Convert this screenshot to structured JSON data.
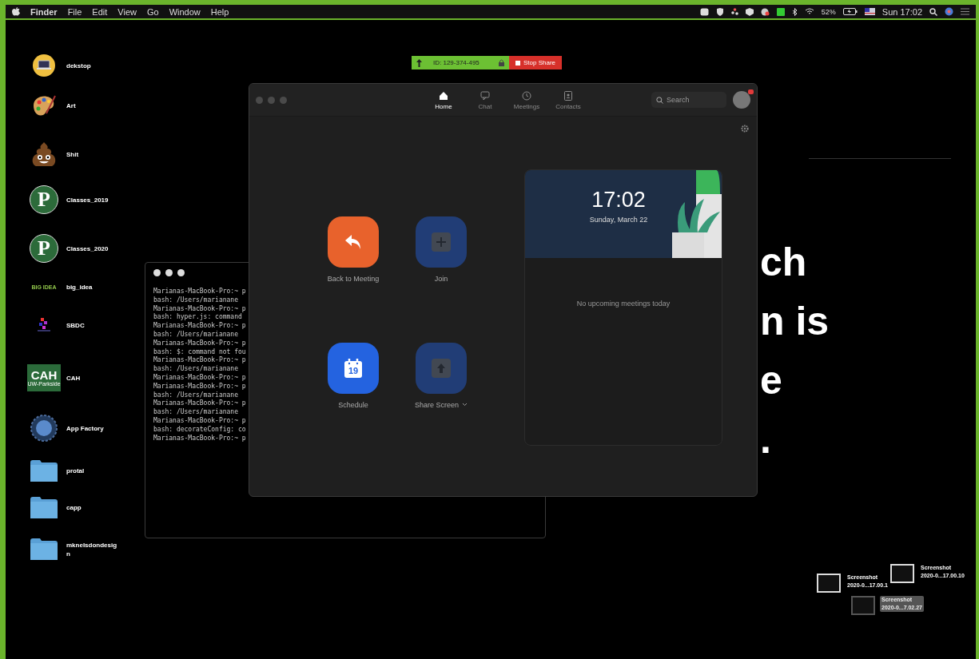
{
  "menu_bar": {
    "app": "Finder",
    "menus": [
      "File",
      "Edit",
      "View",
      "Go",
      "Window",
      "Help"
    ],
    "battery": "52%",
    "clock": "Sun 17:02"
  },
  "desktop_icons": [
    {
      "label": "dekstop",
      "kind": "laptop"
    },
    {
      "label": "Art",
      "kind": "palette"
    },
    {
      "label": "Shit",
      "kind": "emoji"
    },
    {
      "label": "Classes_2019",
      "kind": "p-logo",
      "logo_text": "P"
    },
    {
      "label": "Classes_2020",
      "kind": "p-logo",
      "logo_text": "P"
    },
    {
      "label": "big_idea",
      "kind": "wordmark",
      "logo_text": "BIG IDEA"
    },
    {
      "label": "SBDC",
      "kind": "mini-logo"
    },
    {
      "label": "CAH",
      "kind": "badge-logo",
      "logo_text": "CAH",
      "logo_subtext": "UW-Parkside"
    },
    {
      "label": "App Factory",
      "kind": "gear-logo"
    },
    {
      "label": "protal",
      "kind": "folder"
    },
    {
      "label": "capp",
      "kind": "folder"
    },
    {
      "label": "mknelsdondesig n",
      "kind": "folder"
    }
  ],
  "share_bar": {
    "meeting_id": "ID: 129-374-495",
    "stop_label": "Stop Share"
  },
  "background_text": [
    "ch",
    "n is",
    "e",
    "."
  ],
  "terminal": {
    "lines": [
      "Marianas-MacBook-Pro:~ p",
      "bash: /Users/marianane",
      "Marianas-MacBook-Pro:~ p",
      "bash: hyper.js: command",
      "Marianas-MacBook-Pro:~ p",
      "bash: /Users/marianane",
      "Marianas-MacBook-Pro:~ p",
      "bash: $: command not fou",
      "Marianas-MacBook-Pro:~ p",
      "bash: /Users/marianane",
      "Marianas-MacBook-Pro:~ p",
      "Marianas-MacBook-Pro:~ p",
      "bash: /Users/marianane",
      "Marianas-MacBook-Pro:~ p",
      "bash: /Users/marianane",
      "Marianas-MacBook-Pro:~ p",
      "bash: decorateConfig: co",
      "Marianas-MacBook-Pro:~ p"
    ]
  },
  "zoom_window": {
    "tabs": [
      {
        "label": "Home",
        "kind": "home",
        "selected": true
      },
      {
        "label": "Chat",
        "kind": "chat",
        "selected": false
      },
      {
        "label": "Meetings",
        "kind": "meetings",
        "selected": false
      },
      {
        "label": "Contacts",
        "kind": "contacts",
        "selected": false
      }
    ],
    "search": {
      "placeholder": "Search"
    },
    "actions": [
      {
        "label": "Back to Meeting",
        "kind": "back",
        "disabled": false
      },
      {
        "label": "Join",
        "kind": "join",
        "disabled": true
      },
      {
        "label": "Schedule",
        "kind": "schedule",
        "disabled": false,
        "icon_text": "19"
      },
      {
        "label": "Share Screen",
        "kind": "share",
        "disabled": true,
        "has_menu": true
      }
    ],
    "calendar": {
      "time": "17:02",
      "date": "Sunday, March 22",
      "empty_message": "No upcoming meetings today"
    }
  },
  "screenshots": [
    {
      "title": "Screenshot",
      "name": "2020-0...17.00.1",
      "selected": false
    },
    {
      "title": "Screenshot",
      "name": "2020-0...17.00.10",
      "selected": false
    },
    {
      "title": "Screenshot",
      "name": "2020-0...7.02.27",
      "selected": true
    }
  ]
}
